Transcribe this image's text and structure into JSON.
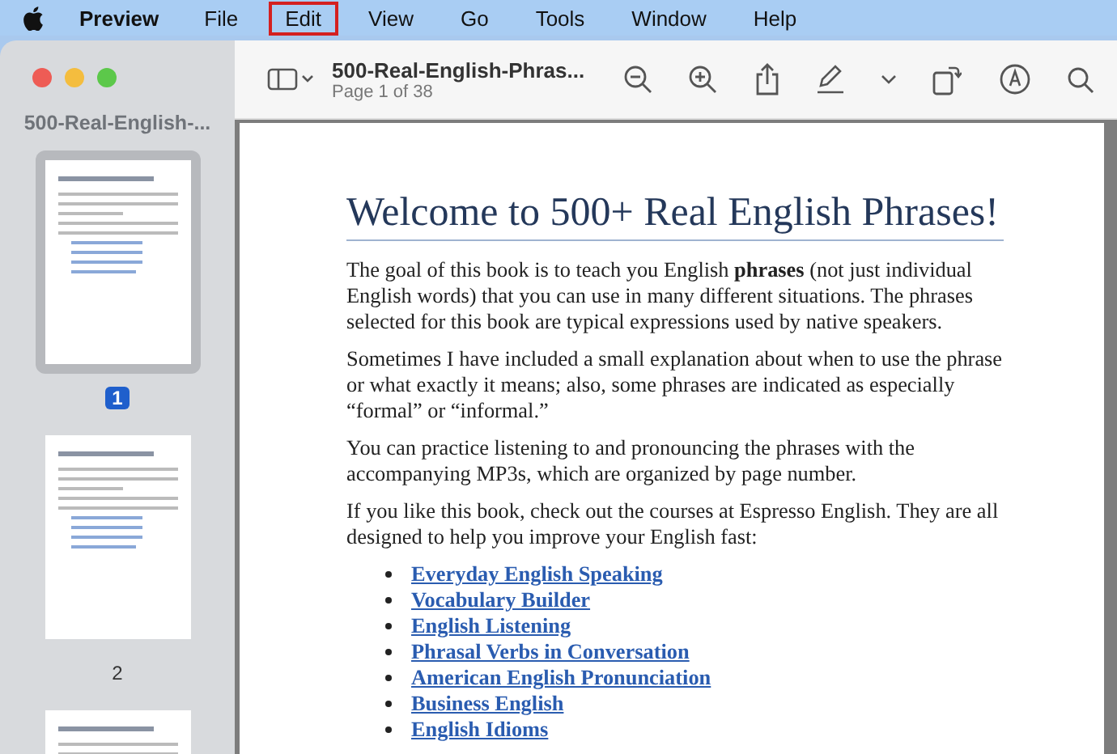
{
  "menu_bar": {
    "app": "Preview",
    "items": [
      {
        "label": "File",
        "selected": false
      },
      {
        "label": "Edit",
        "selected": true
      },
      {
        "label": "View",
        "selected": false
      },
      {
        "label": "Go",
        "selected": false
      },
      {
        "label": "Tools",
        "selected": false
      },
      {
        "label": "Window",
        "selected": false
      },
      {
        "label": "Help",
        "selected": false
      }
    ]
  },
  "sidebar": {
    "title": "500-Real-English-...",
    "pages": [
      {
        "label": "1",
        "selected": true
      },
      {
        "label": "2",
        "selected": false
      },
      {
        "selected": false
      }
    ]
  },
  "toolbar": {
    "title": "500-Real-English-Phras...",
    "subtitle": "Page 1 of 38"
  },
  "document": {
    "heading": "Welcome to 500+ Real English Phrases!",
    "paragraphs": [
      "The goal of this book is to teach you English **phrases** (not just individual English words) that you can use in many different situations. The phrases selected for this book are typical expressions used by native speakers.",
      "Sometimes I have included a small explanation about when to use the phrase or what exactly it means; also, some phrases are indicated as especially “formal” or “informal.”",
      "You can practice listening to and pronouncing the phrases with the accompanying MP3s, which are organized by page number.",
      "If you like this book, check out the courses at Espresso English. They are all designed to help you improve your English fast:"
    ],
    "links": [
      "Everyday English Speaking",
      "Vocabulary Builder",
      "English Listening",
      "Phrasal Verbs in Conversation",
      "American English Pronunciation",
      "Business English",
      "English Idioms"
    ]
  }
}
